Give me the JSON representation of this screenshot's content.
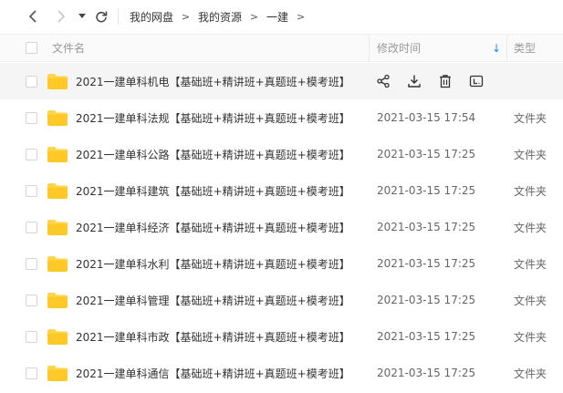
{
  "breadcrumb": [
    {
      "label": "我的网盘"
    },
    {
      "label": "我的资源"
    },
    {
      "label": "一建"
    }
  ],
  "breadcrumb_separator": ">",
  "header": {
    "name_label": "文件名",
    "modified_label": "修改时间",
    "type_label": "类型",
    "sort_indicator": "↓"
  },
  "row_actions": [
    "share-icon",
    "download-icon",
    "delete-icon",
    "rename-icon"
  ],
  "files": [
    {
      "name": "2021一建单科机电【基础班+精讲班+真题班+模考班】",
      "modified": "",
      "type": ""
    },
    {
      "name": "2021一建单科法规【基础班+精讲班+真题班+模考班】",
      "modified": "2021-03-15 17:54",
      "type": "文件夹"
    },
    {
      "name": "2021一建单科公路【基础班+精讲班+真题班+模考班】",
      "modified": "2021-03-15 17:25",
      "type": "文件夹"
    },
    {
      "name": "2021一建单科建筑【基础班+精讲班+真题班+模考班】",
      "modified": "2021-03-15 17:25",
      "type": "文件夹"
    },
    {
      "name": "2021一建单科经济【基础班+精讲班+真题班+模考班】",
      "modified": "2021-03-15 17:25",
      "type": "文件夹"
    },
    {
      "name": "2021一建单科水利【基础班+精讲班+真题班+模考班】",
      "modified": "2021-03-15 17:25",
      "type": "文件夹"
    },
    {
      "name": "2021一建单科管理【基础班+精讲班+真题班+模考班】",
      "modified": "2021-03-15 17:25",
      "type": "文件夹"
    },
    {
      "name": "2021一建单科市政【基础班+精讲班+真题班+模考班】",
      "modified": "2021-03-15 17:25",
      "type": "文件夹"
    },
    {
      "name": "2021一建单科通信【基础班+精讲班+真题班+模考班】",
      "modified": "2021-03-15 17:25",
      "type": "文件夹"
    }
  ],
  "colors": {
    "folder": "#ffd54f",
    "sort_accent": "#1e88e5",
    "hover_row": "#f5f5f5"
  }
}
